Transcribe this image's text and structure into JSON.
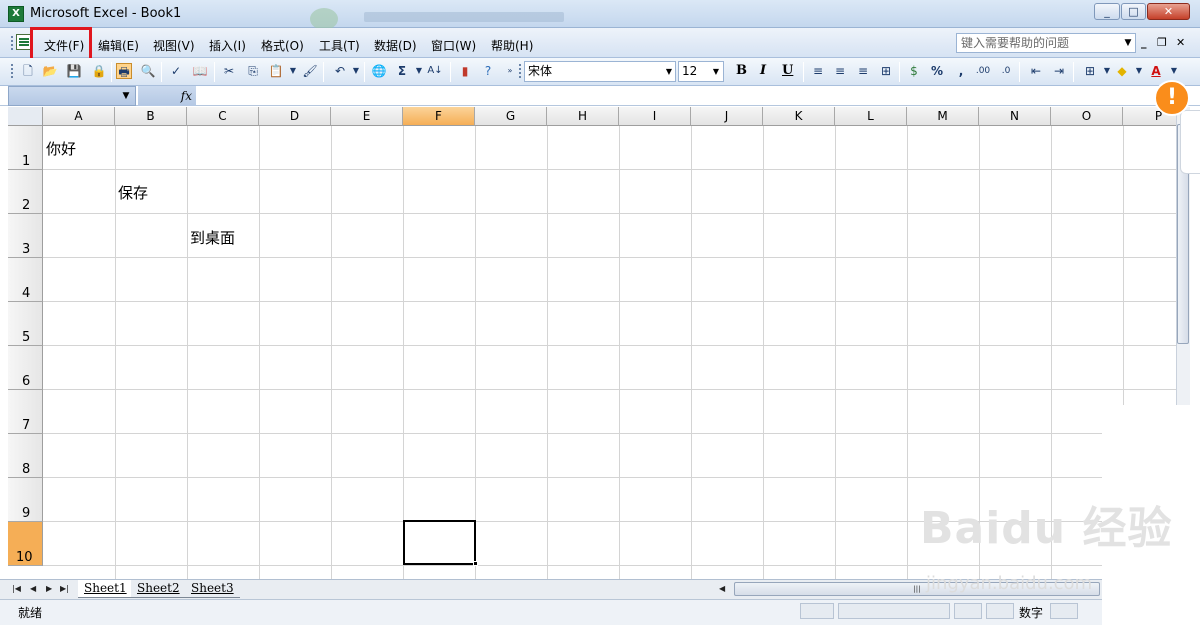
{
  "window": {
    "title": "Microsoft Excel - Book1",
    "app_icon": "X",
    "minimize_icon": "minimize-icon",
    "maximize_icon": "maximize-icon",
    "close_icon": "close-icon"
  },
  "menu": {
    "items": [
      "文件(F)",
      "编辑(E)",
      "视图(V)",
      "插入(I)",
      "格式(O)",
      "工具(T)",
      "数据(D)",
      "窗口(W)",
      "帮助(H)"
    ],
    "highlighted": "文件(F)",
    "help_placeholder": "键入需要帮助的问题"
  },
  "toolbar": {
    "font_name": "宋体",
    "font_size": "12",
    "bold": "B",
    "italic": "I",
    "underline": "U",
    "percent": "%",
    "comma": ",",
    "autosum": "Σ"
  },
  "formula_bar": {
    "name_box": "",
    "fx": "fx",
    "formula": ""
  },
  "grid": {
    "columns": [
      "A",
      "B",
      "C",
      "D",
      "E",
      "F",
      "G",
      "H",
      "I",
      "J",
      "K",
      "L",
      "M",
      "N",
      "O",
      "P"
    ],
    "rows": [
      "1",
      "2",
      "3",
      "4",
      "5",
      "6",
      "7",
      "8",
      "9",
      "10"
    ],
    "active_column": "F",
    "active_row": "10",
    "cells": [
      {
        "ref": "A1",
        "value": "你好"
      },
      {
        "ref": "B2",
        "value": "保存"
      },
      {
        "ref": "C3",
        "value": "到桌面"
      }
    ]
  },
  "sheets": [
    "Sheet1",
    "Sheet2",
    "Sheet3"
  ],
  "active_sheet": "Sheet1",
  "status": {
    "ready": "就绪",
    "num": "数字"
  },
  "overlay": {
    "alert_symbol": "!",
    "watermark": "Baidu 经验",
    "watermark_url": "jingyan.baidu.com"
  },
  "colors": {
    "highlight_box": "#e0161e",
    "active_header": "#f5ae56",
    "alert": "#fa8d1b"
  }
}
